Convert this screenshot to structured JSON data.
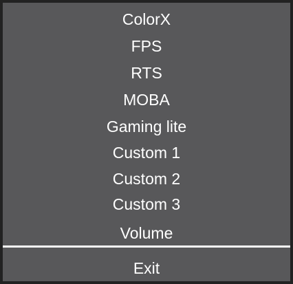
{
  "menu": {
    "items": [
      {
        "label": "ColorX"
      },
      {
        "label": "FPS"
      },
      {
        "label": "RTS"
      },
      {
        "label": "MOBA"
      },
      {
        "label": "Gaming lite"
      },
      {
        "label": "Custom 1"
      },
      {
        "label": "Custom 2"
      },
      {
        "label": "Custom 3"
      },
      {
        "label": "Volume"
      }
    ],
    "exit_label": "Exit"
  },
  "colors": {
    "panel_background": "#58585a",
    "panel_border": "#222222",
    "text": "#ffffff",
    "divider": "#ffffff"
  }
}
